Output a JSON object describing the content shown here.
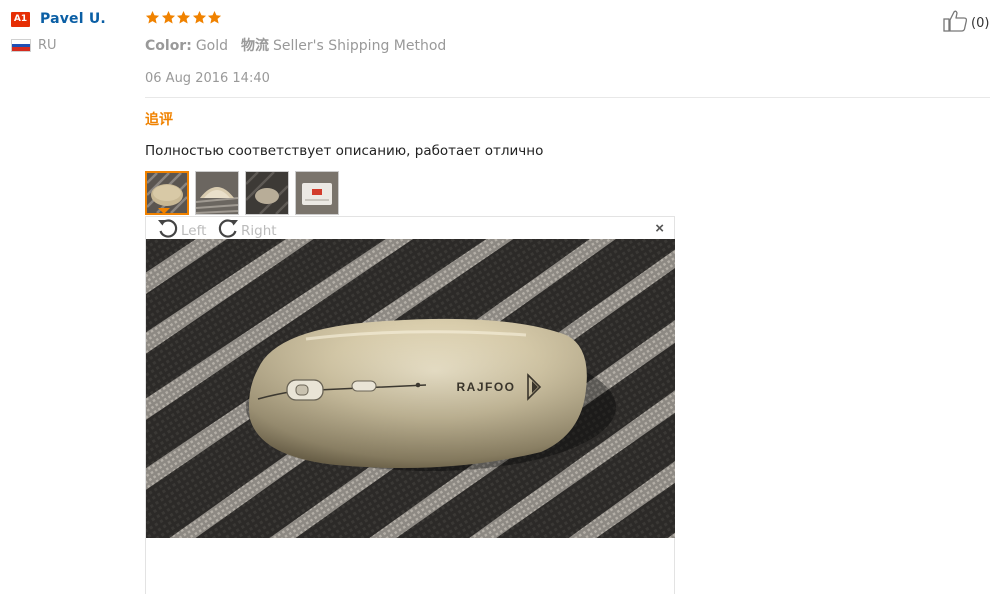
{
  "user": {
    "level_badge": "A1",
    "name": "Pavel U.",
    "country_code": "RU"
  },
  "review": {
    "rating": 5,
    "color_label": "Color:",
    "color_value": "Gold",
    "shipping_label": "物流",
    "shipping_value": "Seller's Shipping Method",
    "date": "06 Aug 2016 14:40",
    "additional_feedback_label": "追评",
    "text": "Полностью соответствует описанию, работает отлично"
  },
  "like": {
    "count": "(0)"
  },
  "viewer": {
    "rotate_left_label": "Left",
    "rotate_right_label": "Right",
    "close_label": "×"
  },
  "colors": {
    "star": "#f08200",
    "accent_orange": "#f08200",
    "name_blue": "#0b5fa5",
    "badge_red": "#e62e04"
  },
  "thumbnails": [
    {
      "name": "thumbnail-gold-mouse-top"
    },
    {
      "name": "thumbnail-mouse-side"
    },
    {
      "name": "thumbnail-mouse-dark"
    },
    {
      "name": "thumbnail-mouse-white"
    }
  ]
}
